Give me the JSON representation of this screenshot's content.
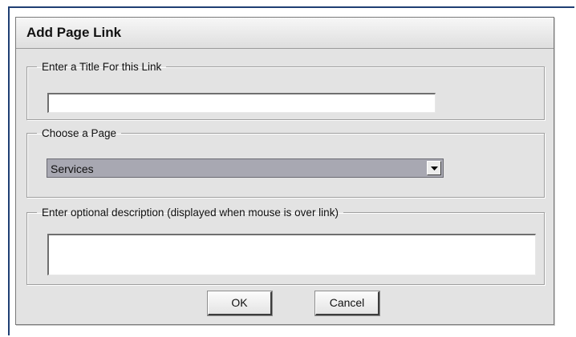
{
  "dialog": {
    "title": "Add Page Link"
  },
  "title_group": {
    "legend": "Enter a Title For this Link",
    "value": ""
  },
  "page_group": {
    "legend": "Choose a Page",
    "selected": "Services",
    "dropdown_icon": "dropdown-arrow-icon"
  },
  "description_group": {
    "legend": "Enter optional description (displayed when mouse is over link)",
    "value": ""
  },
  "buttons": {
    "ok": "OK",
    "cancel": "Cancel"
  },
  "colors": {
    "frame_border": "#1f3f73",
    "dialog_bg": "#e3e3e3",
    "select_bg": "#a8a8b2"
  }
}
